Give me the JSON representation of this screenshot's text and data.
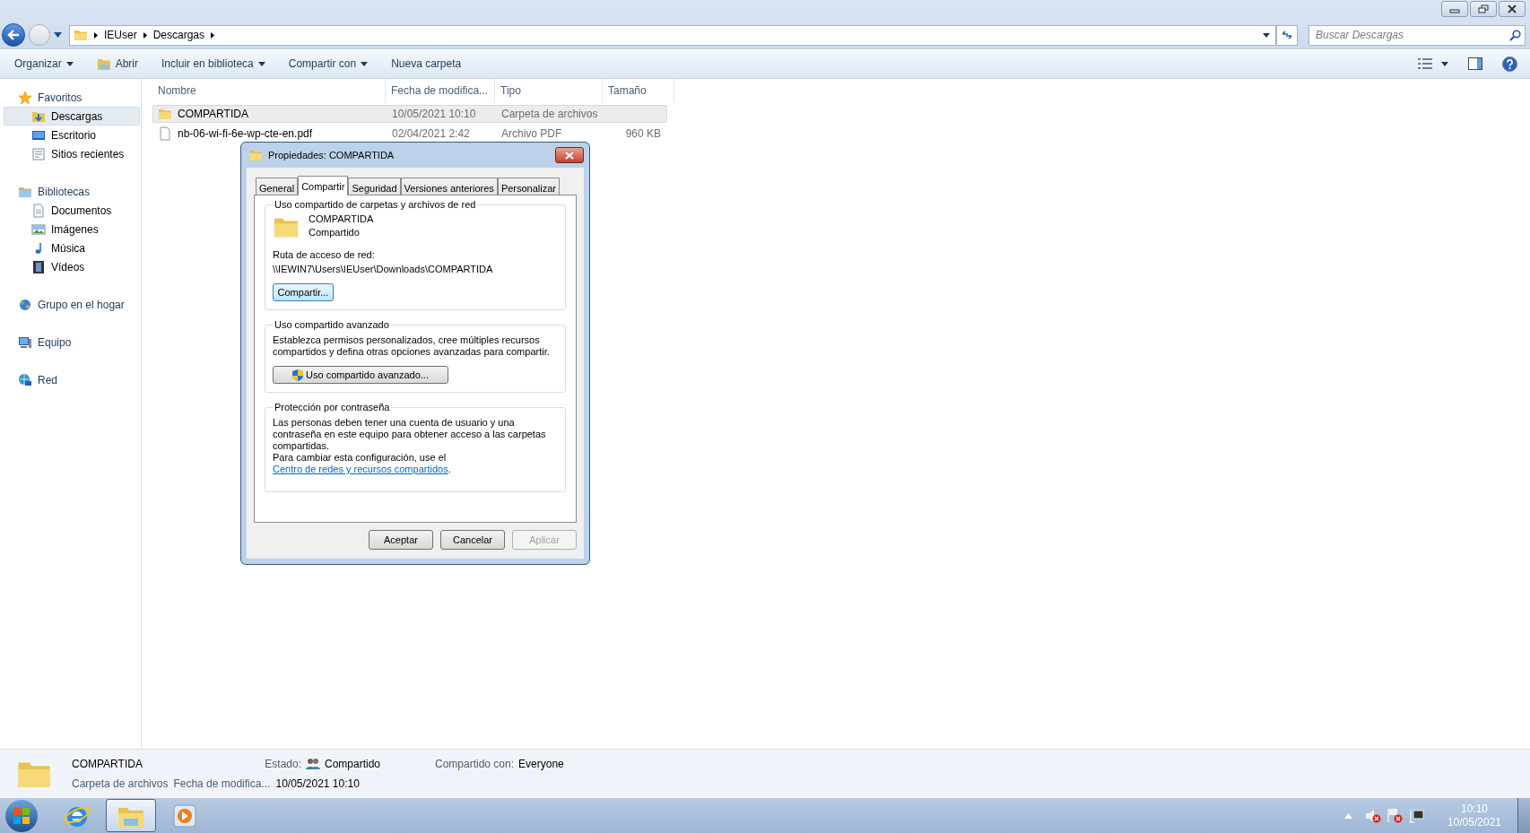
{
  "address_bar": {
    "breadcrumbs": [
      "IEUser",
      "Descargas"
    ]
  },
  "search": {
    "placeholder": "Buscar Descargas"
  },
  "toolbar": {
    "items": [
      {
        "label": "Organizar",
        "dropdown": true,
        "kind": "menu"
      },
      {
        "label": "Abrir",
        "dropdown": false,
        "kind": "open"
      },
      {
        "label": "Incluir en biblioteca",
        "dropdown": true,
        "kind": "menu"
      },
      {
        "label": "Compartir con",
        "dropdown": true,
        "kind": "menu"
      },
      {
        "label": "Nueva carpeta",
        "dropdown": false,
        "kind": "menu"
      }
    ]
  },
  "sidebar": {
    "groups": [
      {
        "label": "Favoritos",
        "items": [
          {
            "label": "Descargas",
            "selected": true
          },
          {
            "label": "Escritorio",
            "selected": false
          },
          {
            "label": "Sitios recientes",
            "selected": false
          }
        ]
      },
      {
        "label": "Bibliotecas",
        "items": [
          {
            "label": "Documentos",
            "selected": false
          },
          {
            "label": "Imágenes",
            "selected": false
          },
          {
            "label": "Música",
            "selected": false
          },
          {
            "label": "Vídeos",
            "selected": false
          }
        ]
      },
      {
        "label": "Grupo en el hogar"
      },
      {
        "label": "Equipo"
      },
      {
        "label": "Red"
      }
    ]
  },
  "file_list": {
    "columns": [
      "Nombre",
      "Fecha de modifica...",
      "Tipo",
      "Tamaño"
    ],
    "rows": [
      {
        "kind": "folder",
        "name": "COMPARTIDA",
        "modified": "10/05/2021 10:10",
        "type": "Carpeta de archivos",
        "selected": true
      },
      {
        "kind": "file",
        "name": "nb-06-wi-fi-6e-wp-cte-en.pdf",
        "modified": "02/04/2021 2:42",
        "type": "Archivo PDF",
        "size": "960 KB",
        "selected": false
      }
    ]
  },
  "dialog": {
    "title": "Propiedades: COMPARTIDA",
    "tabs": [
      {
        "label": "General",
        "selected": false
      },
      {
        "label": "Compartir",
        "selected": true
      },
      {
        "label": "Seguridad",
        "selected": false
      },
      {
        "label": "Versiones anteriores",
        "selected": false
      },
      {
        "label": "Personalizar",
        "selected": false
      }
    ],
    "network_sharing": {
      "title": "Uso compartido de carpetas y archivos de red",
      "folder_name": "COMPARTIDA",
      "status": "Compartido",
      "path_label": "Ruta de acceso de red:",
      "path": "\\\\IEWIN7\\Users\\IEUser\\Downloads\\COMPARTIDA",
      "button": "Compartir..."
    },
    "advanced_sharing": {
      "title": "Uso compartido avanzado",
      "text": "Establezca permisos personalizados, cree múltiples recursos compartidos y defina otras opciones avanzadas para compartir.",
      "button": "Uso compartido avanzado..."
    },
    "password_protection": {
      "title": "Protección por contraseña",
      "text": "Las personas deben tener una cuenta de usuario y una contraseña en este equipo para obtener acceso a las carpetas compartidas.",
      "change_text": "Para cambiar esta configuración, use el",
      "link": "Centro de redes y recursos compartidos",
      "after_link": "."
    },
    "buttons": [
      {
        "label": "Aceptar",
        "disabled": false
      },
      {
        "label": "Cancelar",
        "disabled": false
      },
      {
        "label": "Aplicar",
        "disabled": true
      }
    ]
  },
  "details_pane": {
    "name": "COMPARTIDA",
    "type": "Carpeta de archivos",
    "status_label": "Estado:",
    "status": "Compartido",
    "modified_label": "Fecha de modifica...",
    "modified": "10/05/2021 10:10",
    "shared_with_label": "Compartido con:",
    "shared_with": "Everyone"
  },
  "taskbar": {
    "apps": [
      {
        "kind": "browser",
        "selected": false
      },
      {
        "kind": "explorer",
        "selected": true
      },
      {
        "kind": "media",
        "selected": false
      }
    ],
    "clock": {
      "time": "10:10",
      "date": "10/05/2021"
    }
  }
}
